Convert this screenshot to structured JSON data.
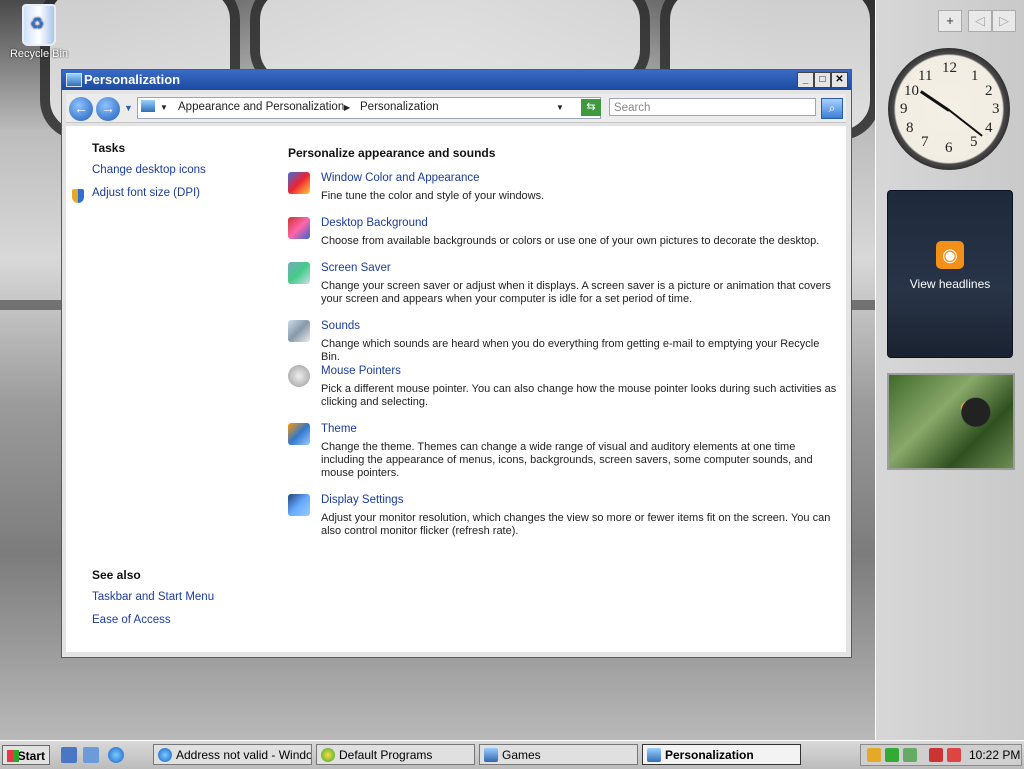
{
  "desktop": {
    "recycle_bin_label": "Recycle Bin"
  },
  "window": {
    "title": "Personalization",
    "address": {
      "crumb1": "Appearance and Personalization",
      "crumb2": "Personalization"
    },
    "search_placeholder": "Search",
    "left_pane": {
      "tasks_heading": "Tasks",
      "tasks": [
        "Change desktop icons",
        "Adjust font size (DPI)"
      ],
      "see_also_heading": "See also",
      "see_also": [
        "Taskbar and Start Menu",
        "Ease of Access"
      ]
    },
    "main": {
      "heading": "Personalize appearance and sounds",
      "items": [
        {
          "title": "Window Color and Appearance",
          "desc": "Fine tune the color and style of your windows.",
          "icon": "window-color-icon"
        },
        {
          "title": "Desktop Background",
          "desc": "Choose from available backgrounds or colors or use one of your own pictures to decorate the desktop.",
          "icon": "desktop-background-icon"
        },
        {
          "title": "Screen Saver",
          "desc": "Change your screen saver or adjust when it displays. A screen saver is a picture or animation that covers your screen and appears when your computer is idle for a set period of time.",
          "icon": "screen-saver-icon"
        },
        {
          "title": "Sounds",
          "desc": "Change which sounds are heard when you do everything from getting e-mail to emptying your Recycle Bin.",
          "icon": "sounds-icon"
        },
        {
          "title": "Mouse Pointers",
          "desc": "Pick a different mouse pointer. You can also change how the mouse pointer looks during such activities as clicking and selecting.",
          "icon": "mouse-pointer-icon"
        },
        {
          "title": "Theme",
          "desc": "Change the theme. Themes can change a wide range of visual and auditory elements at one time including the appearance of menus, icons, backgrounds, screen savers, some computer sounds, and mouse pointers.",
          "icon": "theme-icon"
        },
        {
          "title": "Display Settings",
          "desc": "Adjust your monitor resolution, which changes the view so more or fewer items fit on the screen. You can also control monitor flicker (refresh rate).",
          "icon": "display-settings-icon"
        }
      ]
    }
  },
  "sidebar": {
    "add_label": "+",
    "feed_label": "View headlines",
    "clock_numbers": [
      "12",
      "1",
      "2",
      "3",
      "4",
      "5",
      "6",
      "7",
      "8",
      "9",
      "10",
      "11"
    ]
  },
  "taskbar": {
    "start_label": "Start",
    "items": [
      {
        "label": "Address not valid - Windo..."
      },
      {
        "label": "Default Programs"
      },
      {
        "label": "Games"
      },
      {
        "label": "Personalization"
      }
    ],
    "clock": "10:22 PM"
  },
  "colors": {
    "link": "#1c3c9c",
    "titlebar": "#1c4a9e",
    "rss": "#f39019"
  }
}
